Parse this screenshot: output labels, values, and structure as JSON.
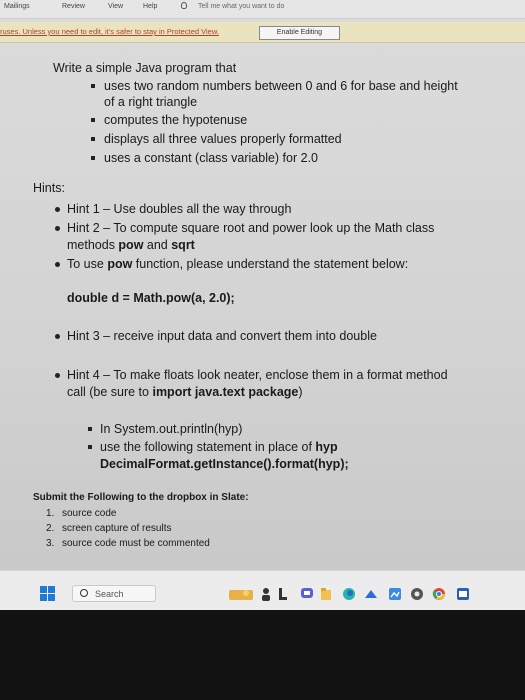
{
  "ribbon": {
    "tabs": [
      "Mailings",
      "Review",
      "View",
      "Help"
    ],
    "tell_me": "Tell me what you want to do"
  },
  "protected_bar": {
    "message": "ruses. Unless you need to edit, it's safer to stay in Protected View.",
    "button": "Enable Editing"
  },
  "document": {
    "intro": "Write a simple Java program that",
    "requirements": [
      "uses two random numbers between 0 and 6 for base and height",
      "of a right triangle",
      "computes the hypotenuse",
      "displays all three values properly formatted",
      "uses a constant (class variable) for 2.0"
    ],
    "hints_title": "Hints:",
    "hint1": "Hint 1 – Use doubles all the way through",
    "hint2_a": "Hint 2 – To compute square root and power look up the Math class",
    "hint2_b1": "methods ",
    "hint2_pow": "pow",
    "hint2_and": " and ",
    "hint2_sqrt": "sqrt",
    "pow_a": "To use ",
    "pow_b": "pow",
    "pow_c": " function, please understand the statement below:",
    "code_line": "double d = Math.pow(a, 2.0);",
    "hint3": "Hint 3 – receive input data and convert them into double",
    "hint4_a": "Hint 4 – To make floats look neater, enclose them in a format method",
    "hint4_b1": "call (be sure to ",
    "hint4_b2": "import java.text package",
    "hint4_b3": ")",
    "sub1": "In System.out.println(hyp)",
    "sub2_a": "use the following statement in place of ",
    "sub2_b": "hyp",
    "sub3": "DecimalFormat.getInstance().format(hyp);",
    "submit_title": "Submit the Following to the dropbox in Slate:",
    "submit_items": [
      "source code",
      "screen capture of results",
      "source code must be commented"
    ],
    "submit_nums": [
      "1.",
      "2.",
      "3."
    ]
  },
  "taskbar": {
    "search_placeholder": "Search"
  },
  "colors": {
    "windows_blue": "#1f7ad6",
    "protected_bar": "#e9e3bf",
    "protected_text": "#b2402b"
  }
}
